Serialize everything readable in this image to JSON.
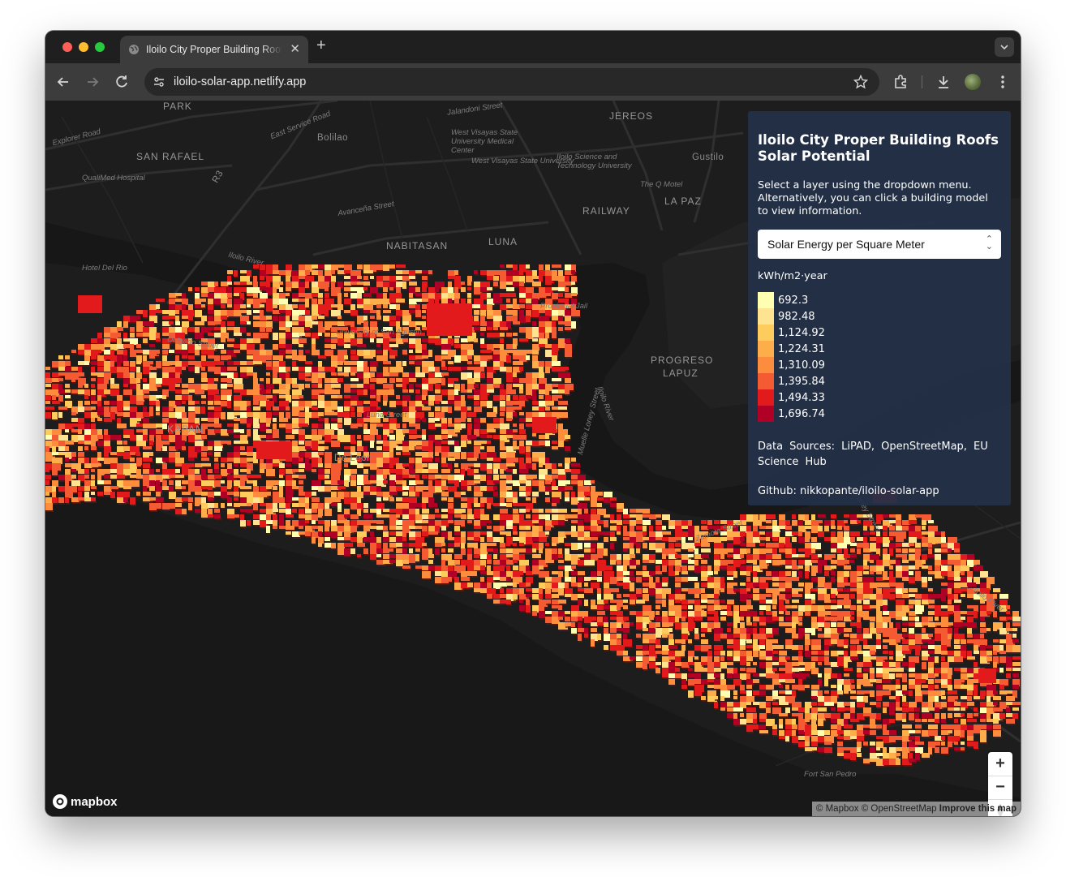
{
  "browser": {
    "tab_title": "Iloilo City Proper Building Roofs Solar Potential",
    "tab_icon": "globe-icon",
    "url": "iloilo-solar-app.netlify.app"
  },
  "map": {
    "labels": [
      {
        "text": "PARK",
        "kind": "district"
      },
      {
        "text": "Explorer Road",
        "kind": "italic"
      },
      {
        "text": "East Service Road",
        "kind": "italic"
      },
      {
        "text": "Jalandoni Street",
        "kind": "italic"
      },
      {
        "text": "JEREOS",
        "kind": "district"
      },
      {
        "text": "SAN RAFAEL",
        "kind": "district"
      },
      {
        "text": "Bolilao",
        "kind": "plain"
      },
      {
        "text": "West Visayas State University Medical Center",
        "kind": "italic"
      },
      {
        "text": "Iloilo Science and Technology University",
        "kind": "italic"
      },
      {
        "text": "Gustilo",
        "kind": "plain"
      },
      {
        "text": "QualiMed Hospital",
        "kind": "italic"
      },
      {
        "text": "R3",
        "kind": "plain"
      },
      {
        "text": "West Visayas State University",
        "kind": "italic"
      },
      {
        "text": "The Q Motel",
        "kind": "italic"
      },
      {
        "text": "LA PAZ",
        "kind": "district"
      },
      {
        "text": "Avanceña Street",
        "kind": "italic"
      },
      {
        "text": "RAILWAY",
        "kind": "district"
      },
      {
        "text": "NABITASAN",
        "kind": "district"
      },
      {
        "text": "LUNA",
        "kind": "district"
      },
      {
        "text": "Iloilo River",
        "kind": "italic"
      },
      {
        "text": "Hotel Del Rio",
        "kind": "italic"
      },
      {
        "text": "Provincial Jail",
        "kind": "italic"
      },
      {
        "text": "PROGRESO",
        "kind": "district"
      },
      {
        "text": "LAPUZ",
        "kind": "district"
      },
      {
        "text": "Delgado Street",
        "kind": "italic"
      },
      {
        "text": "University of San Agustin",
        "kind": "italic"
      },
      {
        "text": "Muelle Loney Street",
        "kind": "italic"
      },
      {
        "text": "Iloilo River",
        "kind": "italic"
      },
      {
        "text": "KAPAN",
        "kind": "district"
      },
      {
        "text": "De Leon",
        "kind": "plain"
      },
      {
        "text": "Luna Street",
        "kind": "italic"
      },
      {
        "text": "Zamora Street",
        "kind": "italic"
      },
      {
        "text": "Loney Street",
        "kind": "italic"
      },
      {
        "text": "Iloilo River",
        "kind": "italic"
      },
      {
        "text": "Fort San Pedro",
        "kind": "italic"
      }
    ],
    "zoom_in_label": "+",
    "zoom_out_label": "−",
    "compass_icon": "compass-icon",
    "logo_text": "mapbox",
    "attribution": {
      "mapbox": "© Mapbox",
      "osm": "© OpenStreetMap",
      "improve": "Improve this map"
    }
  },
  "panel": {
    "title": "Iloilo City Proper Building Roofs Solar Potential",
    "description": "Select a layer using the dropdown menu. Alternatively, you can click a building model to view information.",
    "layer_select": {
      "selected": "Solar Energy per Square Meter",
      "options": [
        "Solar Energy per Square Meter"
      ]
    },
    "legend_unit": "kWh/m2·year",
    "legend": [
      {
        "value": "692.3",
        "color": "#ffffb2"
      },
      {
        "value": "982.48",
        "color": "#fee391"
      },
      {
        "value": "1,124.92",
        "color": "#fecc5c"
      },
      {
        "value": "1,224.31",
        "color": "#fdae4b"
      },
      {
        "value": "1,310.09",
        "color": "#fd8d3c"
      },
      {
        "value": "1,395.84",
        "color": "#f45b32"
      },
      {
        "value": "1,494.33",
        "color": "#e31a1c"
      },
      {
        "value": "1,696.74",
        "color": "#b10026"
      }
    ],
    "sources": "Data Sources: LiPAD, OpenStreetMap, EU Science Hub",
    "github": "Github: nikkopante/iloilo-solar-app"
  },
  "colors": {
    "map_background": "#1d1d1d",
    "water": "#161616",
    "roads": "#2e2e2e",
    "panel_background": "#233048"
  }
}
